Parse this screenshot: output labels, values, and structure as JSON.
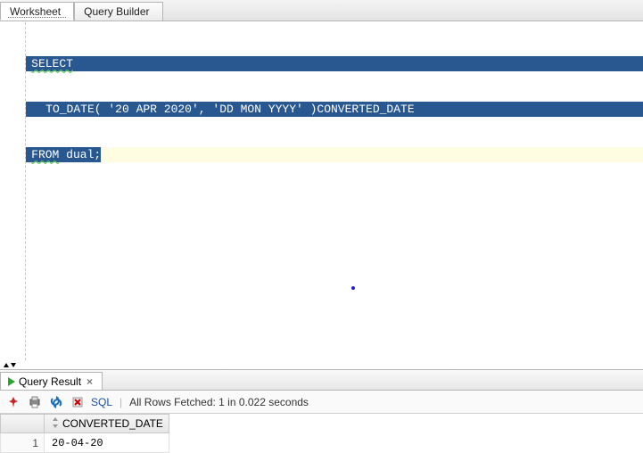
{
  "tabs": {
    "worksheet": "Worksheet",
    "query_builder": "Query Builder"
  },
  "editor": {
    "line1_kw": "SELECT",
    "line2_pre": "  ",
    "line2_code": "TO_DATE( '20 APR 2020', 'DD MON YYYY' )CONVERTED_DATE",
    "line3_kw": "FROM",
    "line3_rest": " dual;"
  },
  "result_tab": {
    "label": "Query Result"
  },
  "toolbar": {
    "sql_label": "SQL",
    "status": "All Rows Fetched: 1 in 0.022 seconds"
  },
  "grid": {
    "columns": [
      "CONVERTED_DATE"
    ],
    "rows": [
      {
        "num": "1",
        "cells": [
          "20-04-20"
        ]
      }
    ]
  }
}
